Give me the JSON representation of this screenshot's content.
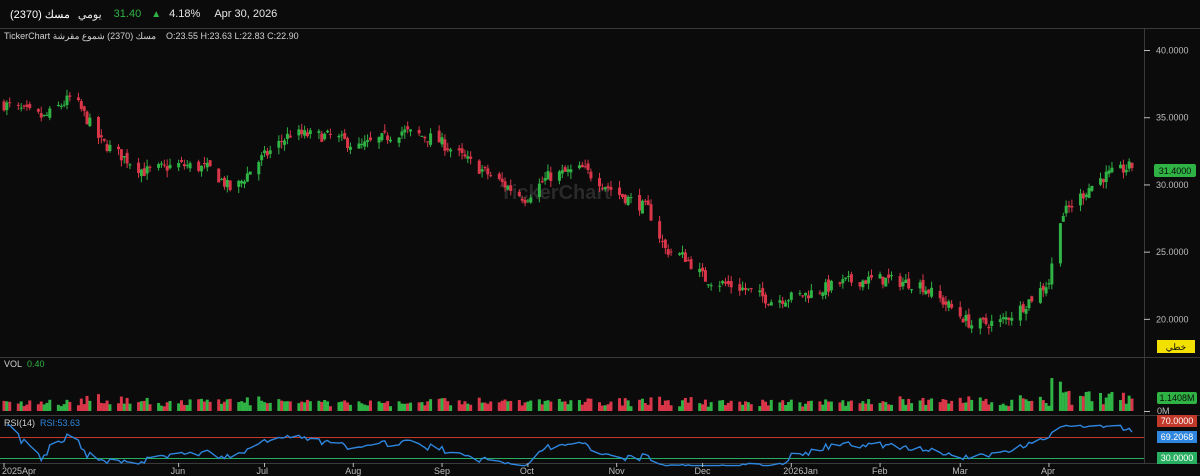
{
  "header": {
    "symbol": "مسك (2370)",
    "period": "يومي",
    "price": "31.40",
    "change_pct": "4.18%",
    "date": "Apr 30, 2026"
  },
  "legend": {
    "title": "TickerChart  مسك (2370) شموع مقرشة",
    "ohlc": "O:23.55  H:23.63  L:22.83  C:22.90"
  },
  "watermark": "TickerChart",
  "price_pane": {
    "last_price_label": "31.4000",
    "mode_label": "خطي"
  },
  "volume_pane": {
    "label": "VOL",
    "value": "0.40",
    "last_label": "1.1408M",
    "zero_label": "0M"
  },
  "rsi_pane": {
    "label": "RSI(14)",
    "value_text": "RSI:53.63",
    "upper_label": "70.0000",
    "current_label": "69.2068",
    "lower_label": "30.0000"
  },
  "colors": {
    "up": "#2fb344",
    "down": "#d9364a",
    "rsi_line": "#2e86de",
    "rsi_band": "#c0392b",
    "rsi_lower": "#27ae60",
    "accent_yellow": "#f1e000"
  },
  "chart_data": [
    {
      "type": "candlestick",
      "title": "",
      "x_ticks": [
        "2025Apr",
        "Jun",
        "Jul",
        "Aug",
        "Sep",
        "Oct",
        "Nov",
        "Dec",
        "2026Jan",
        "Feb",
        "Mar",
        "Apr"
      ],
      "y_ticks": [
        "40.0000",
        "35.0000",
        "30.0000",
        "25.0000",
        "20.0000"
      ],
      "ylim": [
        17.2,
        41.6
      ],
      "months": [
        "2025-04",
        "2025-05",
        "2025-06",
        "2025-07",
        "2025-08",
        "2025-09",
        "2025-10",
        "2025-11",
        "2025-12",
        "2026-01",
        "2026-02",
        "2026-03",
        "2026-04"
      ],
      "close_path": [
        [
          "2025-04-01",
          36.0
        ],
        [
          "2025-04-15",
          35.0
        ],
        [
          "2025-04-25",
          36.6
        ],
        [
          "2025-05-05",
          33.2
        ],
        [
          "2025-05-20",
          31.0
        ],
        [
          "2025-06-01",
          31.5
        ],
        [
          "2025-06-12",
          31.2
        ],
        [
          "2025-06-20",
          29.5
        ],
        [
          "2025-06-28",
          31.6
        ],
        [
          "2025-07-10",
          33.8
        ],
        [
          "2025-07-25",
          33.6
        ],
        [
          "2025-08-03",
          32.8
        ],
        [
          "2025-08-18",
          34.0
        ],
        [
          "2025-08-30",
          33.4
        ],
        [
          "2025-09-10",
          31.8
        ],
        [
          "2025-09-20",
          30.4
        ],
        [
          "2025-09-30",
          29.0
        ],
        [
          "2025-10-08",
          30.6
        ],
        [
          "2025-10-20",
          31.2
        ],
        [
          "2025-11-01",
          29.4
        ],
        [
          "2025-11-12",
          28.2
        ],
        [
          "2025-11-18",
          25.2
        ],
        [
          "2025-11-25",
          24.6
        ],
        [
          "2025-12-02",
          23.0
        ],
        [
          "2025-12-15",
          22.3
        ],
        [
          "2025-12-25",
          21.4
        ],
        [
          "2026-01-05",
          21.8
        ],
        [
          "2026-01-20",
          22.8
        ],
        [
          "2026-02-01",
          23.0
        ],
        [
          "2026-02-15",
          22.6
        ],
        [
          "2026-02-25",
          21.0
        ],
        [
          "2026-03-05",
          19.6
        ],
        [
          "2026-03-15",
          19.8
        ],
        [
          "2026-03-22",
          20.8
        ],
        [
          "2026-04-01",
          22.8
        ],
        [
          "2026-04-05",
          27.6
        ],
        [
          "2026-04-15",
          29.8
        ],
        [
          "2026-04-20",
          30.6
        ],
        [
          "2026-04-30",
          31.4
        ]
      ]
    },
    {
      "type": "bar",
      "title": "VOL",
      "last_value": "1.1408M"
    },
    {
      "type": "line",
      "title": "RSI(14)",
      "ylim": [
        0,
        100
      ],
      "levels": [
        70,
        30
      ],
      "last_value": 69.2068
    }
  ]
}
